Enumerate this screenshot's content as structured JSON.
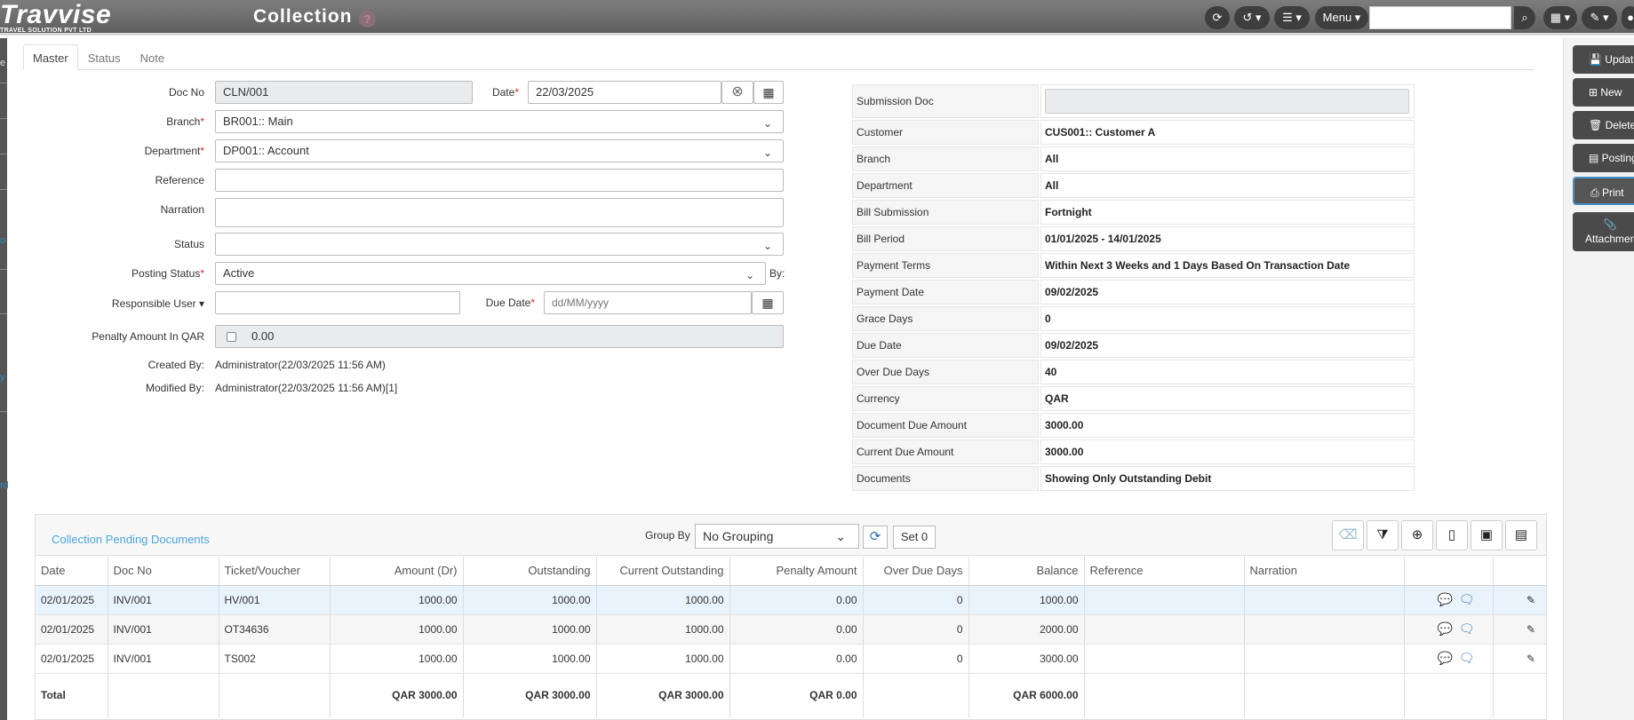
{
  "app": {
    "logo": "Travvise",
    "logo_tagline": "TRAVEL SOLUTION PVT LTD",
    "title": "Collection",
    "help": "?"
  },
  "topbar": {
    "menu_label": "Menu",
    "search_value": ""
  },
  "tabs": [
    "Master",
    "Status",
    "Note"
  ],
  "left": {
    "doc_no_label": "Doc No",
    "doc_no": "CLN/001",
    "date_label": "Date",
    "date": "22/03/2025",
    "branch_label": "Branch",
    "branch": "BR001:: Main",
    "department_label": "Department",
    "department": "DP001:: Account",
    "reference_label": "Reference",
    "reference": "",
    "narration_label": "Narration",
    "narration": "",
    "status_label": "Status",
    "status": "",
    "posting_status_label": "Posting Status",
    "posting_status": "Active",
    "by_label": "By:",
    "responsible_user_label": "Responsible User",
    "responsible_user": "",
    "due_date_label": "Due Date",
    "due_date_placeholder": "dd/MM/yyyy",
    "penalty_label": "Penalty Amount In QAR",
    "penalty": "0.00",
    "created_by_label": "Created By:",
    "created_by": "Administrator(22/03/2025 11:56 AM)",
    "modified_by_label": "Modified By:",
    "modified_by": "Administrator(22/03/2025 11:56 AM)[1]"
  },
  "summary": [
    {
      "label": "Submission Doc",
      "value": ""
    },
    {
      "label": "Customer",
      "value": "CUS001:: Customer A"
    },
    {
      "label": "Branch",
      "value": "All"
    },
    {
      "label": "Department",
      "value": "All"
    },
    {
      "label": "Bill Submission",
      "value": "Fortnight"
    },
    {
      "label": "Bill Period",
      "value": "01/01/2025 - 14/01/2025"
    },
    {
      "label": "Payment Terms",
      "value": "Within Next 3 Weeks and 1 Days Based On Transaction Date"
    },
    {
      "label": "Payment Date",
      "value": "09/02/2025"
    },
    {
      "label": "Grace Days",
      "value": "0"
    },
    {
      "label": "Due Date",
      "value": "09/02/2025"
    },
    {
      "label": "Over Due Days",
      "value": "40"
    },
    {
      "label": "Currency",
      "value": "QAR"
    },
    {
      "label": "Document Due Amount",
      "value": "3000.00"
    },
    {
      "label": "Current Due Amount",
      "value": "3000.00"
    },
    {
      "label": "Documents",
      "value": "Showing Only Outstanding Debit"
    }
  ],
  "right_actions": [
    "Update",
    "New",
    "Delete",
    "Posting",
    "Print",
    "Attachment"
  ],
  "grid": {
    "title": "Collection Pending Documents",
    "group_by_label": "Group By",
    "group_by": "No Grouping",
    "set_label": "Set 0",
    "columns": [
      "Date",
      "Doc No",
      "Ticket/Voucher",
      "Amount (Dr)",
      "Outstanding",
      "Current Outstanding",
      "Penalty Amount",
      "Over Due Days",
      "Balance",
      "Reference",
      "Narration"
    ],
    "rows": [
      [
        "02/01/2025",
        "INV/001",
        "HV/001",
        "1000.00",
        "1000.00",
        "1000.00",
        "0.00",
        "0",
        "1000.00",
        "",
        ""
      ],
      [
        "02/01/2025",
        "INV/001",
        "OT34636",
        "1000.00",
        "1000.00",
        "1000.00",
        "0.00",
        "0",
        "2000.00",
        "",
        ""
      ],
      [
        "02/01/2025",
        "INV/001",
        "TS002",
        "1000.00",
        "1000.00",
        "1000.00",
        "0.00",
        "0",
        "3000.00",
        "",
        ""
      ]
    ],
    "total": {
      "label": "Total",
      "amount": "QAR 3000.00",
      "outstanding": "QAR 3000.00",
      "current": "QAR 3000.00",
      "penalty": "QAR 0.00",
      "balance": "QAR 6000.00"
    }
  },
  "colors": {
    "accent": "#2e6fb5",
    "title_blue": "#4aa6dc",
    "required": "#c9302c"
  }
}
